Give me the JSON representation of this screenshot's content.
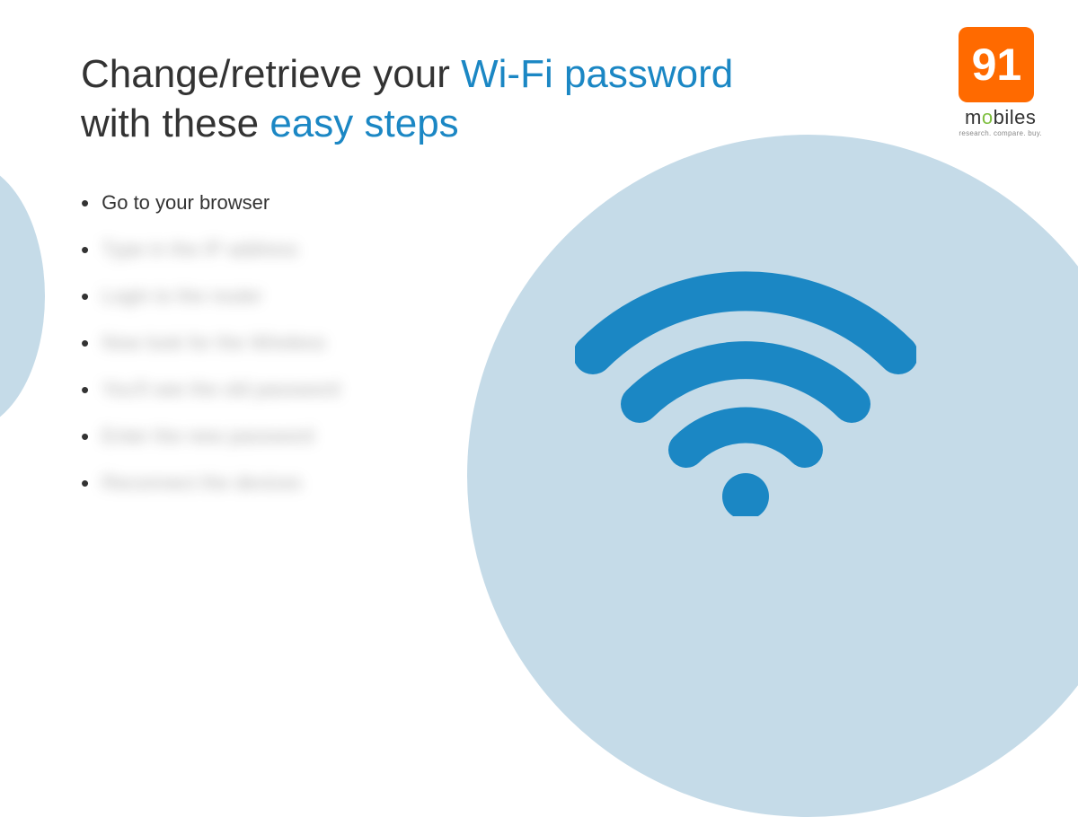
{
  "headline": {
    "part1": "Change/retrieve your ",
    "accent1": "Wi-Fi password",
    "part2": "with these ",
    "accent2": "easy steps"
  },
  "steps": {
    "visible": "Go to your browser",
    "blurred": [
      "Type in the IP address",
      "Login to the router",
      "Now look for the Wireless",
      "You'll see the old password",
      "Enter the new password",
      "Reconnect the devices"
    ]
  },
  "logo": {
    "number": "91",
    "word_pre": "m",
    "word_power": "o",
    "word_post": "biles",
    "tagline": "research. compare. buy."
  },
  "colors": {
    "accent_blue": "#1b87c4",
    "circle_blue": "#c5dbe8",
    "logo_orange": "#ff6a00",
    "logo_green": "#7fbf3f"
  }
}
